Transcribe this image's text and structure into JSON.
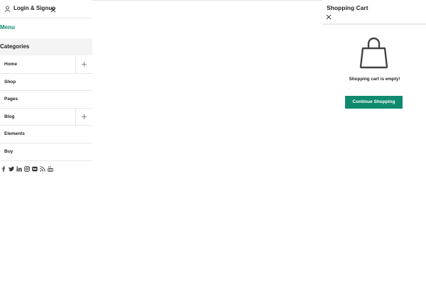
{
  "left_panel": {
    "login_label": "Login & Signup",
    "menu_tab": "Menu",
    "categories_tab": "Categories",
    "items": [
      {
        "label": "Home",
        "expandable": true
      },
      {
        "label": "Shop",
        "expandable": false
      },
      {
        "label": "Pages",
        "expandable": false
      },
      {
        "label": "Blog",
        "expandable": true
      },
      {
        "label": "Elements",
        "expandable": false
      },
      {
        "label": "Buy",
        "expandable": false
      }
    ],
    "social_icons": [
      "facebook-icon",
      "twitter-icon",
      "linkedin-icon",
      "instagram-icon",
      "flickr-icon",
      "rss-icon",
      "youtube-icon"
    ]
  },
  "cart": {
    "title": "Shopping Cart",
    "empty_message": "Shopping cart is empty!",
    "continue_label": "Continue Shopping"
  },
  "colors": {
    "accent": "#0f8a6e",
    "divider": "#e6e6e6",
    "text": "#222222"
  }
}
